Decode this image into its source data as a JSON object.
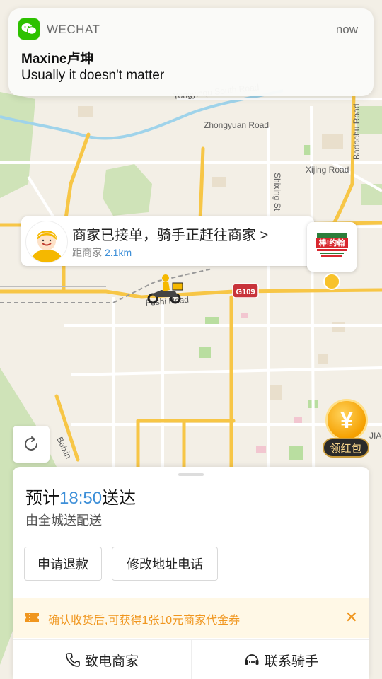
{
  "notification": {
    "app_name": "WECHAT",
    "time": "now",
    "title": "Maxine卢坤",
    "body": "Usually it doesn't matter"
  },
  "map": {
    "road_labels": [
      "Yongyinqu South Road",
      "Zhongyuan Road",
      "Xijing Road",
      "Shixing St",
      "Badachu Road",
      "Fushi Road",
      "Beixin",
      "G109",
      "JIAO"
    ]
  },
  "rider": {
    "status": "商家已接单，骑手正赶往商家 >",
    "distance_label": "距商家",
    "distance_value": "2.1km"
  },
  "merchant": {
    "logo_text": "棒!约翰"
  },
  "red_packet": {
    "label": "领红包",
    "symbol": "¥"
  },
  "order": {
    "eta_prefix": "预计",
    "eta_time": "18:50",
    "eta_suffix": "送达",
    "delivery_by": "由全城送配送",
    "refund_button": "申请退款",
    "address_button": "修改地址电话",
    "coupon_text": "确认收货后,可获得1张10元商家代金券",
    "coupon_close": "✕",
    "call_merchant": "致电商家",
    "contact_rider": "联系骑手"
  },
  "colors": {
    "accent_blue": "#3d8fd8",
    "coupon_orange": "#f0961e",
    "wechat_green": "#2dc100",
    "road_yellow": "#f7c646"
  }
}
